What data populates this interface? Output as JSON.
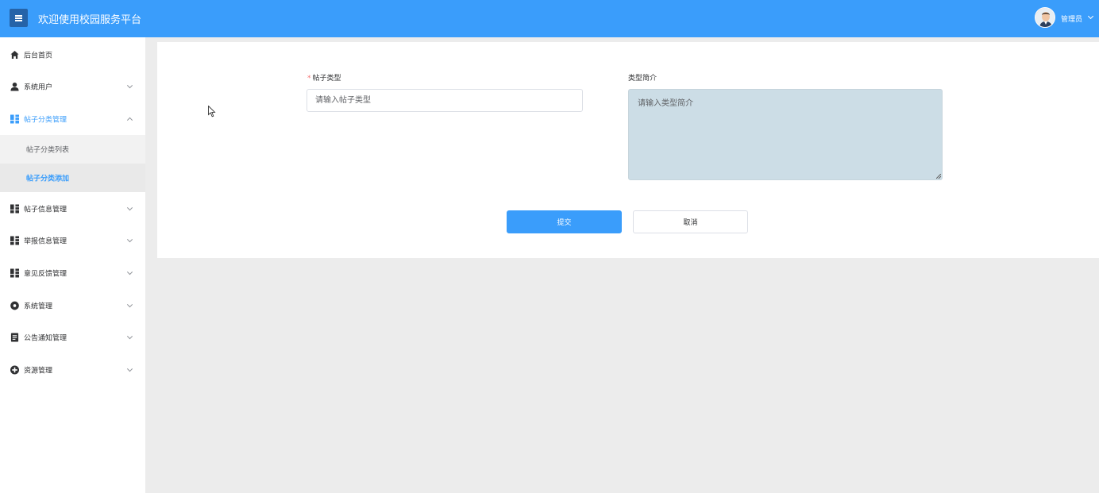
{
  "header": {
    "menu_icon": "hamburger-icon",
    "title": "欢迎使用校园服务平台",
    "user_name": "管理员",
    "colors": {
      "bar": "#3a9dfb",
      "toggle": "#2563a8"
    }
  },
  "sidebar": {
    "items": [
      {
        "label": "后台首页",
        "icon": "home-icon"
      },
      {
        "label": "系统用户",
        "icon": "user-icon",
        "expandable": true
      },
      {
        "label": "帖子分类管理",
        "icon": "grid-icon",
        "expandable": true,
        "expanded": true,
        "children": [
          {
            "label": "帖子分类列表"
          },
          {
            "label": "帖子分类添加",
            "selected": true
          }
        ]
      },
      {
        "label": "帖子信息管理",
        "icon": "grid-icon",
        "expandable": true
      },
      {
        "label": "举报信息管理",
        "icon": "grid-icon",
        "expandable": true
      },
      {
        "label": "意见反馈管理",
        "icon": "grid-icon",
        "expandable": true
      },
      {
        "label": "系统管理",
        "icon": "gear-icon",
        "expandable": true
      },
      {
        "label": "公告通知管理",
        "icon": "document-icon",
        "expandable": true
      },
      {
        "label": "资源管理",
        "icon": "plus-circle-icon",
        "expandable": true
      }
    ],
    "accent_color": "#3a9dfb"
  },
  "form": {
    "type_label": "帖子类型",
    "type_required_mark": "*",
    "type_placeholder": "请输入帖子类型",
    "type_value": "",
    "intro_label": "类型简介",
    "intro_placeholder": "请输入类型简介",
    "intro_value": "",
    "submit_label": "提交",
    "cancel_label": "取消"
  }
}
